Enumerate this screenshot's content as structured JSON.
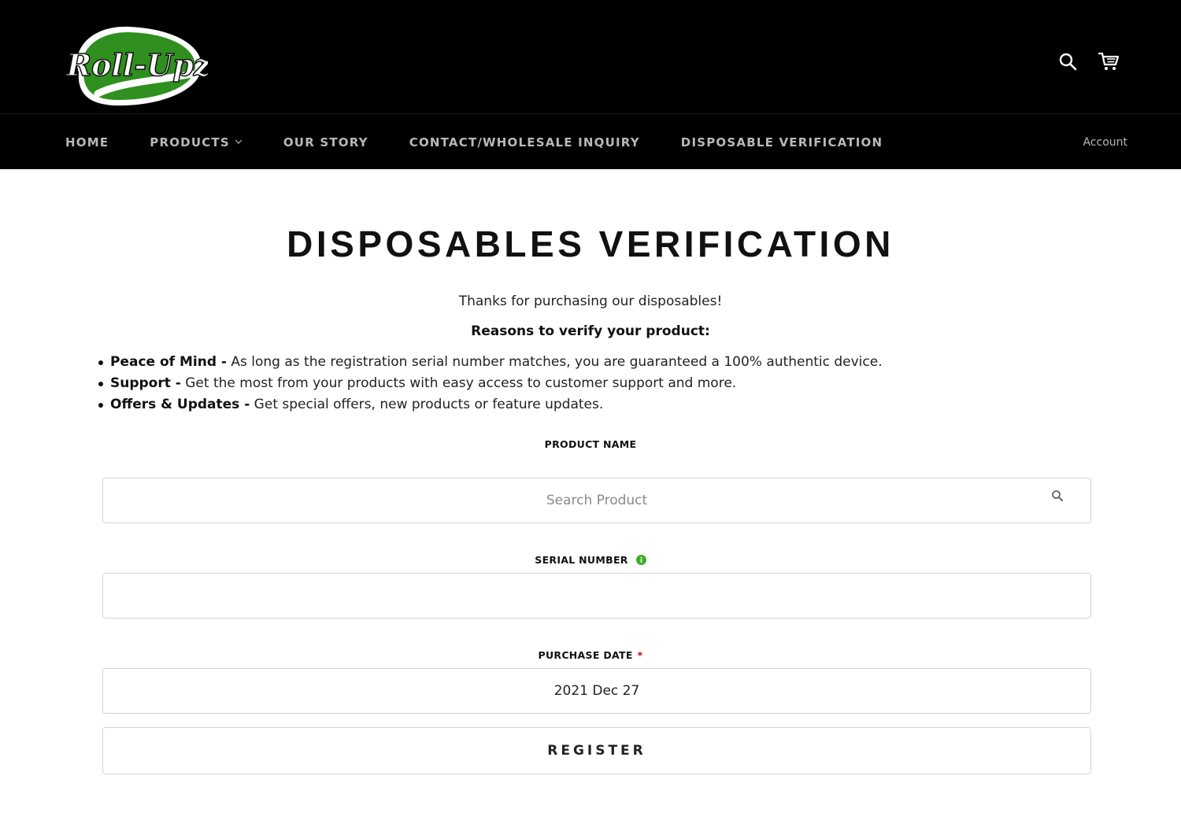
{
  "brand": {
    "logo_text": "Roll-Upz",
    "primary_color": "#000000",
    "accent_green": "#3fae2a"
  },
  "header": {
    "icons": [
      "search-icon",
      "cart-icon"
    ]
  },
  "nav": {
    "items": [
      {
        "label": "HOME"
      },
      {
        "label": "PRODUCTS",
        "has_dropdown": true
      },
      {
        "label": "OUR STORY"
      },
      {
        "label": "CONTACT/WHOLESALE INQUIRY"
      },
      {
        "label": "DISPOSABLE VERIFICATION"
      }
    ],
    "account_label": "Account"
  },
  "page": {
    "title": "DISPOSABLES VERIFICATION",
    "intro": "Thanks for purchasing our disposables!",
    "reasons_heading": "Reasons to verify your product:",
    "reasons": [
      {
        "title": "Peace of Mind -",
        "text": " As long as the registration serial number matches, you are guaranteed a 100% authentic device."
      },
      {
        "title": "Support -",
        "text": " Get the most from your products with easy access to customer support and more."
      },
      {
        "title": "Offers & Updates -",
        "text": " Get special offers, new products or feature updates."
      }
    ]
  },
  "form": {
    "product_name_label": "PRODUCT NAME",
    "product_placeholder": "Search Product",
    "serial_label": "SERIAL NUMBER",
    "serial_value": "",
    "purchase_date_label": "PURCHASE DATE",
    "required_mark": "*",
    "purchase_date_value": "2021 Dec 27",
    "register_label": "REGISTER"
  }
}
